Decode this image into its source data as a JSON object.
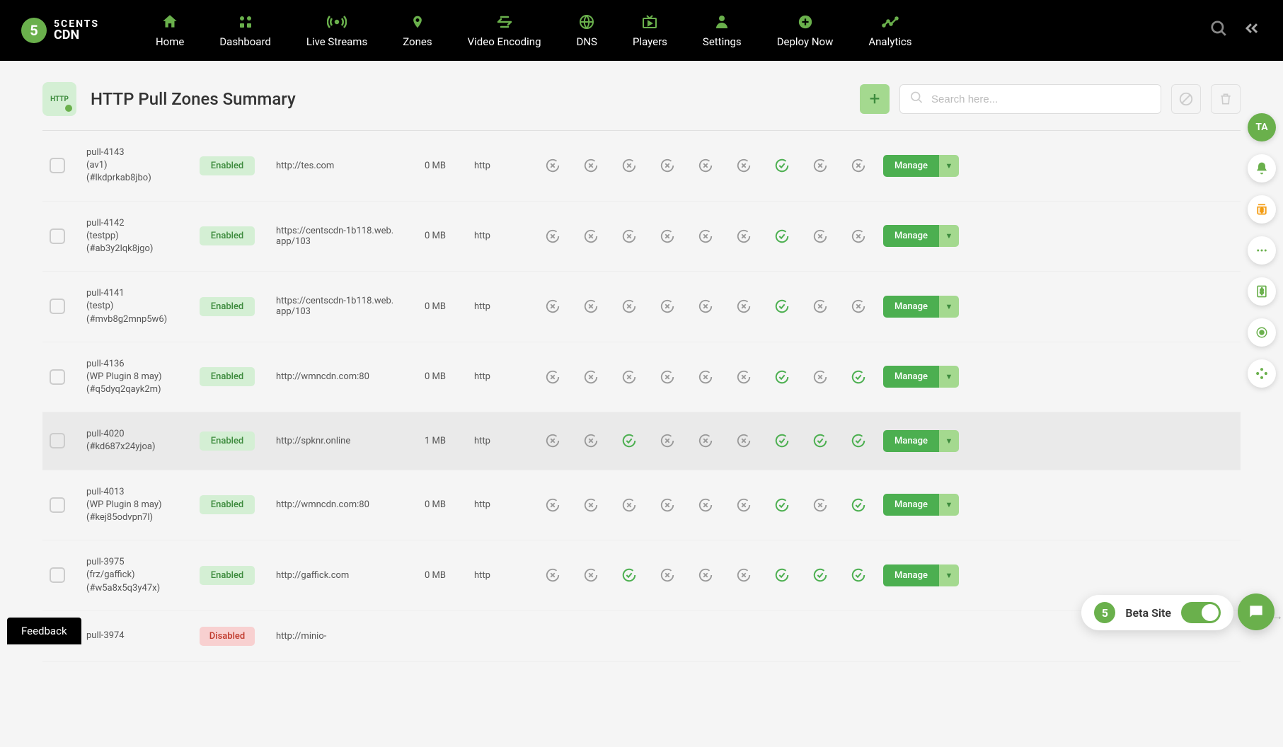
{
  "brand": {
    "name_top": "5CENTS",
    "name_bottom": "CDN",
    "mark": "5"
  },
  "nav": [
    {
      "label": "Home",
      "icon": "home"
    },
    {
      "label": "Dashboard",
      "icon": "grid"
    },
    {
      "label": "Live Streams",
      "icon": "broadcast"
    },
    {
      "label": "Zones",
      "icon": "pin"
    },
    {
      "label": "Video Encoding",
      "icon": "encode"
    },
    {
      "label": "DNS",
      "icon": "globe"
    },
    {
      "label": "Players",
      "icon": "tv"
    },
    {
      "label": "Settings",
      "icon": "user"
    },
    {
      "label": "Deploy Now",
      "icon": "plus"
    },
    {
      "label": "Analytics",
      "icon": "chart"
    }
  ],
  "page": {
    "title": "HTTP Pull Zones Summary",
    "search_placeholder": "Search here...",
    "http_badge": "HTTP"
  },
  "avatar": "TA",
  "actions": {
    "manage": "Manage"
  },
  "rows": [
    {
      "name": "pull-4143",
      "sub": "(av1)",
      "hash": "(#lkdprkab8jbo)",
      "status": "Enabled",
      "origin": "http://tes.com",
      "size": "0 MB",
      "type": "http",
      "flags": [
        "x",
        "x",
        "x",
        "x",
        "x",
        "x",
        "ok",
        "x",
        "x"
      ]
    },
    {
      "name": "pull-4142",
      "sub": "(testpp)",
      "hash": "(#ab3y2lqk8jgo)",
      "status": "Enabled",
      "origin": "https://centscdn-1b118.web.app/103",
      "size": "0 MB",
      "type": "http",
      "flags": [
        "x",
        "x",
        "x",
        "x",
        "x",
        "x",
        "ok",
        "x",
        "x"
      ]
    },
    {
      "name": "pull-4141",
      "sub": "(testp)",
      "hash": "(#mvb8g2mnp5w6)",
      "status": "Enabled",
      "origin": "https://centscdn-1b118.web.app/103",
      "size": "0 MB",
      "type": "http",
      "flags": [
        "x",
        "x",
        "x",
        "x",
        "x",
        "x",
        "ok",
        "x",
        "x"
      ]
    },
    {
      "name": "pull-4136",
      "sub": "(WP Plugin 8 may)",
      "hash": "(#q5dyq2qayk2m)",
      "status": "Enabled",
      "origin": "http://wmncdn.com:80",
      "size": "0 MB",
      "type": "http",
      "flags": [
        "x",
        "x",
        "x",
        "x",
        "x",
        "x",
        "ok",
        "x",
        "ok"
      ]
    },
    {
      "name": "pull-4020",
      "sub": "",
      "hash": "(#kd687x24yjoa)",
      "status": "Enabled",
      "origin": "http://spknr.online",
      "size": "1 MB",
      "type": "http",
      "flags": [
        "x",
        "x",
        "ok",
        "x",
        "x",
        "x",
        "ok",
        "ok",
        "ok"
      ],
      "hover": true
    },
    {
      "name": "pull-4013",
      "sub": "(WP Plugin 8 may)",
      "hash": "(#kej85odvpn7l)",
      "status": "Enabled",
      "origin": "http://wmncdn.com:80",
      "size": "0 MB",
      "type": "http",
      "flags": [
        "x",
        "x",
        "x",
        "x",
        "x",
        "x",
        "ok",
        "x",
        "ok"
      ]
    },
    {
      "name": "pull-3975",
      "sub": "(frz/gaffick)",
      "hash": "(#w5a8x5q3y47x)",
      "status": "Enabled",
      "origin": "http://gaffick.com",
      "size": "0 MB",
      "type": "http",
      "flags": [
        "x",
        "x",
        "ok",
        "x",
        "x",
        "x",
        "ok",
        "ok",
        "ok"
      ]
    },
    {
      "name": "pull-3974",
      "sub": "",
      "hash": "",
      "status": "Disabled",
      "origin": "http://minio-",
      "size": "",
      "type": "",
      "flags": [],
      "partial": true
    }
  ],
  "footer": {
    "feedback": "Feedback",
    "beta": "Beta Site"
  }
}
